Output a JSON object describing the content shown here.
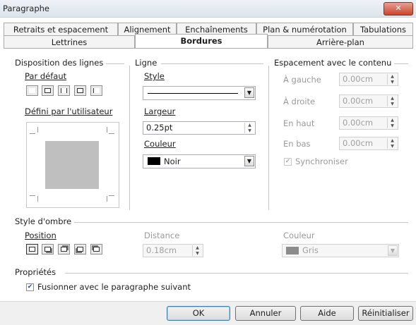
{
  "window": {
    "title": "Paragraphe",
    "close_label": "✕"
  },
  "tabs_row1": [
    "Retraits et espacement",
    "Alignement",
    "Enchaînements",
    "Plan & numérotation",
    "Tabulations"
  ],
  "tabs_row2": [
    "Lettrines",
    "Bordures",
    "Arrière-plan"
  ],
  "selected_tab": "Bordures",
  "line_arrangement": {
    "heading": "Disposition des lignes",
    "default_label": "Par défaut",
    "user_defined_label": "Défini par l'utilisateur"
  },
  "line": {
    "heading": "Ligne",
    "style_label": "Style",
    "width_label": "Largeur",
    "width_value": "0.25pt",
    "color_label": "Couleur",
    "color_value": "Noir",
    "color_swatch": "#000000"
  },
  "spacing": {
    "heading": "Espacement avec le contenu",
    "left_label": "À gauche",
    "left_value": "0.00cm",
    "right_label": "À droite",
    "right_value": "0.00cm",
    "top_label": "En haut",
    "top_value": "0.00cm",
    "bottom_label": "En bas",
    "bottom_value": "0.00cm",
    "sync_label": "Synchroniser",
    "sync_checked": true
  },
  "shadow": {
    "heading": "Style d'ombre",
    "position_label": "Position",
    "distance_label": "Distance",
    "distance_value": "0.18cm",
    "color_label": "Couleur",
    "color_value": "Gris",
    "color_swatch": "#808080"
  },
  "properties": {
    "heading": "Propriétés",
    "merge_label": "Fusionner avec le paragraphe suivant",
    "merge_checked": true
  },
  "buttons": {
    "ok": "OK",
    "cancel": "Annuler",
    "help": "Aide",
    "reset": "Réinitialiser"
  },
  "colors": {
    "accent": "#3c7fb1"
  }
}
